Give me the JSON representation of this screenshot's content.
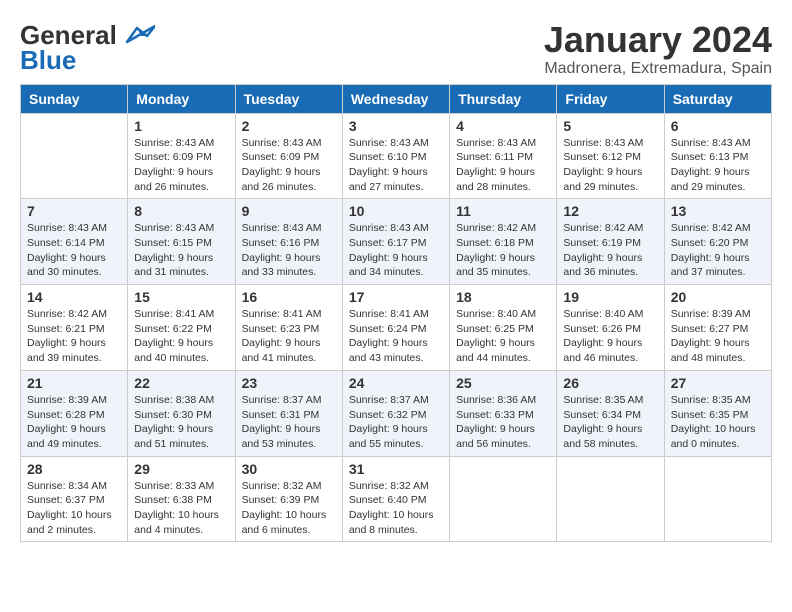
{
  "header": {
    "logo_general": "General",
    "logo_blue": "Blue",
    "month_title": "January 2024",
    "location": "Madronera, Extremadura, Spain"
  },
  "days_of_week": [
    "Sunday",
    "Monday",
    "Tuesday",
    "Wednesday",
    "Thursday",
    "Friday",
    "Saturday"
  ],
  "weeks": [
    [
      {
        "day": "",
        "sunrise": "",
        "sunset": "",
        "daylight": ""
      },
      {
        "day": "1",
        "sunrise": "Sunrise: 8:43 AM",
        "sunset": "Sunset: 6:09 PM",
        "daylight": "Daylight: 9 hours and 26 minutes."
      },
      {
        "day": "2",
        "sunrise": "Sunrise: 8:43 AM",
        "sunset": "Sunset: 6:09 PM",
        "daylight": "Daylight: 9 hours and 26 minutes."
      },
      {
        "day": "3",
        "sunrise": "Sunrise: 8:43 AM",
        "sunset": "Sunset: 6:10 PM",
        "daylight": "Daylight: 9 hours and 27 minutes."
      },
      {
        "day": "4",
        "sunrise": "Sunrise: 8:43 AM",
        "sunset": "Sunset: 6:11 PM",
        "daylight": "Daylight: 9 hours and 28 minutes."
      },
      {
        "day": "5",
        "sunrise": "Sunrise: 8:43 AM",
        "sunset": "Sunset: 6:12 PM",
        "daylight": "Daylight: 9 hours and 29 minutes."
      },
      {
        "day": "6",
        "sunrise": "Sunrise: 8:43 AM",
        "sunset": "Sunset: 6:13 PM",
        "daylight": "Daylight: 9 hours and 29 minutes."
      }
    ],
    [
      {
        "day": "7",
        "sunrise": "Sunrise: 8:43 AM",
        "sunset": "Sunset: 6:14 PM",
        "daylight": "Daylight: 9 hours and 30 minutes."
      },
      {
        "day": "8",
        "sunrise": "Sunrise: 8:43 AM",
        "sunset": "Sunset: 6:15 PM",
        "daylight": "Daylight: 9 hours and 31 minutes."
      },
      {
        "day": "9",
        "sunrise": "Sunrise: 8:43 AM",
        "sunset": "Sunset: 6:16 PM",
        "daylight": "Daylight: 9 hours and 33 minutes."
      },
      {
        "day": "10",
        "sunrise": "Sunrise: 8:43 AM",
        "sunset": "Sunset: 6:17 PM",
        "daylight": "Daylight: 9 hours and 34 minutes."
      },
      {
        "day": "11",
        "sunrise": "Sunrise: 8:42 AM",
        "sunset": "Sunset: 6:18 PM",
        "daylight": "Daylight: 9 hours and 35 minutes."
      },
      {
        "day": "12",
        "sunrise": "Sunrise: 8:42 AM",
        "sunset": "Sunset: 6:19 PM",
        "daylight": "Daylight: 9 hours and 36 minutes."
      },
      {
        "day": "13",
        "sunrise": "Sunrise: 8:42 AM",
        "sunset": "Sunset: 6:20 PM",
        "daylight": "Daylight: 9 hours and 37 minutes."
      }
    ],
    [
      {
        "day": "14",
        "sunrise": "Sunrise: 8:42 AM",
        "sunset": "Sunset: 6:21 PM",
        "daylight": "Daylight: 9 hours and 39 minutes."
      },
      {
        "day": "15",
        "sunrise": "Sunrise: 8:41 AM",
        "sunset": "Sunset: 6:22 PM",
        "daylight": "Daylight: 9 hours and 40 minutes."
      },
      {
        "day": "16",
        "sunrise": "Sunrise: 8:41 AM",
        "sunset": "Sunset: 6:23 PM",
        "daylight": "Daylight: 9 hours and 41 minutes."
      },
      {
        "day": "17",
        "sunrise": "Sunrise: 8:41 AM",
        "sunset": "Sunset: 6:24 PM",
        "daylight": "Daylight: 9 hours and 43 minutes."
      },
      {
        "day": "18",
        "sunrise": "Sunrise: 8:40 AM",
        "sunset": "Sunset: 6:25 PM",
        "daylight": "Daylight: 9 hours and 44 minutes."
      },
      {
        "day": "19",
        "sunrise": "Sunrise: 8:40 AM",
        "sunset": "Sunset: 6:26 PM",
        "daylight": "Daylight: 9 hours and 46 minutes."
      },
      {
        "day": "20",
        "sunrise": "Sunrise: 8:39 AM",
        "sunset": "Sunset: 6:27 PM",
        "daylight": "Daylight: 9 hours and 48 minutes."
      }
    ],
    [
      {
        "day": "21",
        "sunrise": "Sunrise: 8:39 AM",
        "sunset": "Sunset: 6:28 PM",
        "daylight": "Daylight: 9 hours and 49 minutes."
      },
      {
        "day": "22",
        "sunrise": "Sunrise: 8:38 AM",
        "sunset": "Sunset: 6:30 PM",
        "daylight": "Daylight: 9 hours and 51 minutes."
      },
      {
        "day": "23",
        "sunrise": "Sunrise: 8:37 AM",
        "sunset": "Sunset: 6:31 PM",
        "daylight": "Daylight: 9 hours and 53 minutes."
      },
      {
        "day": "24",
        "sunrise": "Sunrise: 8:37 AM",
        "sunset": "Sunset: 6:32 PM",
        "daylight": "Daylight: 9 hours and 55 minutes."
      },
      {
        "day": "25",
        "sunrise": "Sunrise: 8:36 AM",
        "sunset": "Sunset: 6:33 PM",
        "daylight": "Daylight: 9 hours and 56 minutes."
      },
      {
        "day": "26",
        "sunrise": "Sunrise: 8:35 AM",
        "sunset": "Sunset: 6:34 PM",
        "daylight": "Daylight: 9 hours and 58 minutes."
      },
      {
        "day": "27",
        "sunrise": "Sunrise: 8:35 AM",
        "sunset": "Sunset: 6:35 PM",
        "daylight": "Daylight: 10 hours and 0 minutes."
      }
    ],
    [
      {
        "day": "28",
        "sunrise": "Sunrise: 8:34 AM",
        "sunset": "Sunset: 6:37 PM",
        "daylight": "Daylight: 10 hours and 2 minutes."
      },
      {
        "day": "29",
        "sunrise": "Sunrise: 8:33 AM",
        "sunset": "Sunset: 6:38 PM",
        "daylight": "Daylight: 10 hours and 4 minutes."
      },
      {
        "day": "30",
        "sunrise": "Sunrise: 8:32 AM",
        "sunset": "Sunset: 6:39 PM",
        "daylight": "Daylight: 10 hours and 6 minutes."
      },
      {
        "day": "31",
        "sunrise": "Sunrise: 8:32 AM",
        "sunset": "Sunset: 6:40 PM",
        "daylight": "Daylight: 10 hours and 8 minutes."
      },
      {
        "day": "",
        "sunrise": "",
        "sunset": "",
        "daylight": ""
      },
      {
        "day": "",
        "sunrise": "",
        "sunset": "",
        "daylight": ""
      },
      {
        "day": "",
        "sunrise": "",
        "sunset": "",
        "daylight": ""
      }
    ]
  ]
}
